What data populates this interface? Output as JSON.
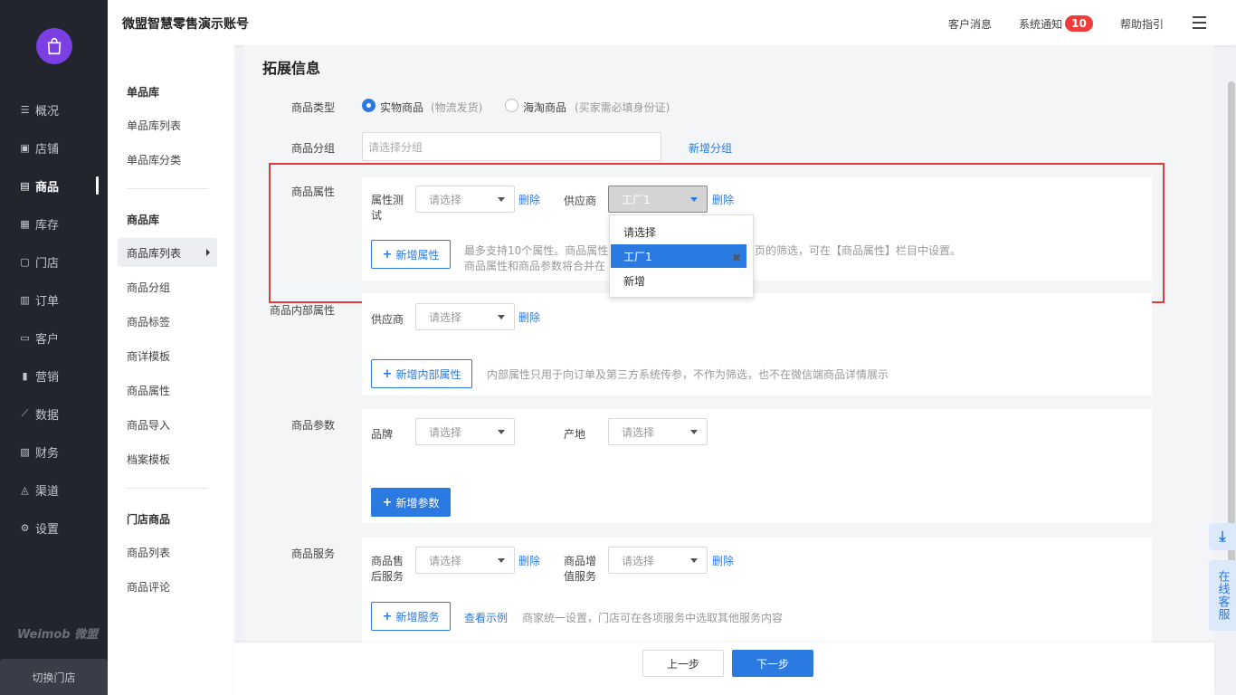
{
  "header": {
    "account": "微盟智慧零售演示账号",
    "customer_msg": "客户消息",
    "system_notice": "系统通知",
    "notice_count": "10",
    "help": "帮助指引"
  },
  "sidebar": {
    "items": [
      {
        "label": "概况",
        "icon": "overview-icon"
      },
      {
        "label": "店铺",
        "icon": "store-icon"
      },
      {
        "label": "商品",
        "icon": "goods-icon"
      },
      {
        "label": "库存",
        "icon": "inventory-icon"
      },
      {
        "label": "门店",
        "icon": "shop-icon"
      },
      {
        "label": "订单",
        "icon": "order-icon"
      },
      {
        "label": "客户",
        "icon": "customer-icon"
      },
      {
        "label": "营销",
        "icon": "marketing-icon"
      },
      {
        "label": "数据",
        "icon": "data-icon"
      },
      {
        "label": "财务",
        "icon": "finance-icon"
      },
      {
        "label": "渠道",
        "icon": "channel-icon"
      },
      {
        "label": "设置",
        "icon": "settings-icon"
      }
    ],
    "active": "商品",
    "brand": "Weimob 微盟",
    "switch_store": "切换门店"
  },
  "subnav": {
    "s1": "单品库",
    "s1_items": [
      "单品库列表",
      "单品库分类"
    ],
    "s2": "商品库",
    "s2_items": [
      "商品库列表",
      "商品分组",
      "商品标签",
      "商详模板",
      "商品属性",
      "商品导入",
      "档案模板"
    ],
    "s3": "门店商品",
    "s3_items": [
      "商品列表",
      "商品评论"
    ]
  },
  "form": {
    "title": "拓展信息",
    "type_label": "商品类型",
    "type_opt1": "实物商品",
    "type_opt1_note": "(物流发货)",
    "type_opt2": "海淘商品",
    "type_opt2_note": "(买家需必填身份证)",
    "group_label": "商品分组",
    "group_placeholder": "请选择分组",
    "group_add": "新增分组",
    "attr_label": "商品属性",
    "attr_test_label": "属性测试",
    "select_placeholder": "请选择",
    "delete": "删除",
    "supplier_label": "供应商",
    "supplier_value": "工厂1",
    "add_attr": "新增属性",
    "attr_note1": "最多支持10个属性。商品属性",
    "attr_note1b": "页的筛选，可在【商品属性】栏目中设置。",
    "attr_note2": "商品属性和商品参数将合并在",
    "dropdown": [
      "请选择",
      "工厂1",
      "新增"
    ],
    "internal_label": "商品内部属性",
    "internal_supplier": "供应商",
    "add_internal": "新增内部属性",
    "internal_note": "内部属性只用于向订单及第三方系统传参，不作为筛选，也不在微信端商品详情展示",
    "param_label": "商品参数",
    "brand_label": "品牌",
    "origin_label": "产地",
    "add_param": "新增参数",
    "service_label": "商品服务",
    "after_sale_label": "商品售后服务",
    "value_added_label": "商品增值服务",
    "add_service": "新增服务",
    "view_example": "查看示例",
    "service_note": "商家统一设置，门店可在各项服务中选取其他服务内容"
  },
  "footer": {
    "prev": "上一步",
    "next": "下一步"
  },
  "helper": {
    "online_service": "在线客服"
  },
  "colors": {
    "primary": "#2a7ae2",
    "highlight": "#e23b3b",
    "sidebar": "#22252e",
    "badge": "#ee3c3c"
  }
}
